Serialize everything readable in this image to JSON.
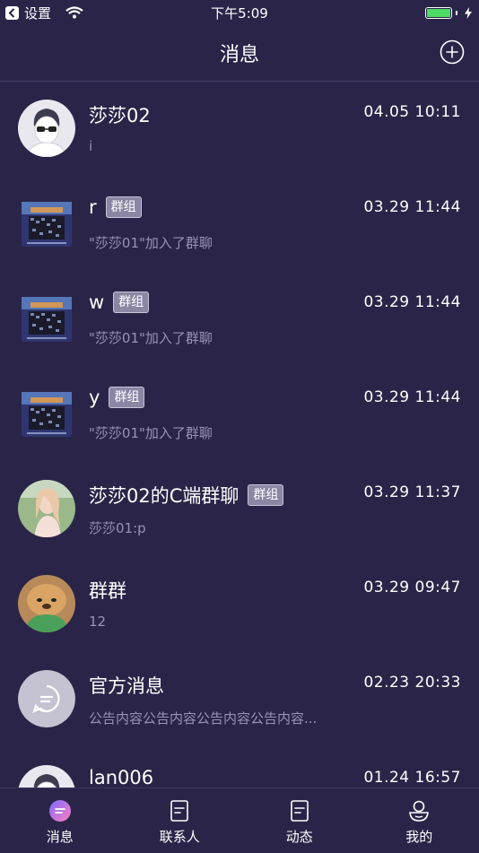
{
  "status_bar": {
    "back_label": "设置",
    "time": "下午5:09"
  },
  "header": {
    "title": "消息"
  },
  "messages": [
    {
      "name": "莎莎02",
      "badge": "",
      "time": "04.05 10:11",
      "preview": "i",
      "avatar": "person"
    },
    {
      "name": "r",
      "badge": "群组",
      "time": "03.29 11:44",
      "preview": "\"莎莎01\"加入了群聊",
      "avatar": "group"
    },
    {
      "name": "w",
      "badge": "群组",
      "time": "03.29 11:44",
      "preview": "\"莎莎01\"加入了群聊",
      "avatar": "group"
    },
    {
      "name": "y",
      "badge": "群组",
      "time": "03.29 11:44",
      "preview": "\"莎莎01\"加入了群聊",
      "avatar": "group"
    },
    {
      "name": "莎莎02的C端群聊",
      "badge": "群组",
      "time": "03.29 11:37",
      "preview": "莎莎01:p",
      "avatar": "photo-girl"
    },
    {
      "name": "群群",
      "badge": "",
      "time": "03.29 09:47",
      "preview": "12",
      "avatar": "photo-dog"
    },
    {
      "name": "官方消息",
      "badge": "",
      "time": "02.23 20:33",
      "preview": "公告内容公告内容公告内容公告内容...",
      "avatar": "official"
    },
    {
      "name": "lan006",
      "badge": "",
      "time": "01.24 16:57",
      "preview": "",
      "avatar": "person"
    }
  ],
  "tabs": [
    {
      "label": "消息",
      "icon": "chat-bubble-icon",
      "active": true
    },
    {
      "label": "联系人",
      "icon": "contacts-icon",
      "active": false
    },
    {
      "label": "动态",
      "icon": "feed-icon",
      "active": false
    },
    {
      "label": "我的",
      "icon": "profile-icon",
      "active": false
    }
  ],
  "colors": {
    "background": "#2a2548",
    "preview_text": "#9792b6",
    "badge_bg": "#8a86a4",
    "active_tab_gradient_start": "#7b6cff",
    "active_tab_gradient_end": "#ff7fbf"
  }
}
